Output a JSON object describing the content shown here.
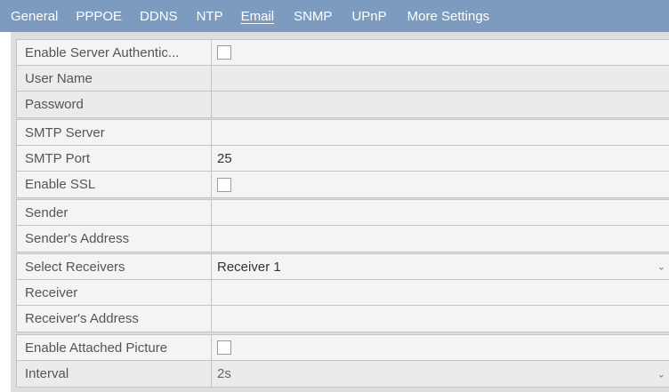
{
  "tabs": [
    {
      "label": "General"
    },
    {
      "label": "PPPOE"
    },
    {
      "label": "DDNS"
    },
    {
      "label": "NTP"
    },
    {
      "label": "Email"
    },
    {
      "label": "SNMP"
    },
    {
      "label": "UPnP"
    },
    {
      "label": "More Settings"
    }
  ],
  "active_tab": "Email",
  "auth": {
    "enable_label": "Enable Server Authentic...",
    "enable_checked": false,
    "username_label": "User Name",
    "username_value": "",
    "password_label": "Password",
    "password_value": ""
  },
  "smtp": {
    "server_label": "SMTP Server",
    "server_value": "",
    "port_label": "SMTP Port",
    "port_value": "25",
    "ssl_label": "Enable SSL",
    "ssl_checked": false
  },
  "sender": {
    "name_label": "Sender",
    "name_value": "",
    "address_label": "Sender's Address",
    "address_value": ""
  },
  "receivers": {
    "select_label": "Select Receivers",
    "select_value": "Receiver 1",
    "receiver_label": "Receiver",
    "receiver_value": "",
    "address_label": "Receiver's Address",
    "address_value": ""
  },
  "picture": {
    "attach_label": "Enable Attached Picture",
    "attach_checked": false,
    "interval_label": "Interval",
    "interval_value": "2s"
  },
  "colors": {
    "tabbar_bg": "#7d9bbf",
    "panel_bg": "#dedede",
    "field_bg": "#f4f4f4"
  },
  "icons": {
    "dropdown": "chevron-down-icon",
    "checkbox": "checkbox-icon"
  }
}
